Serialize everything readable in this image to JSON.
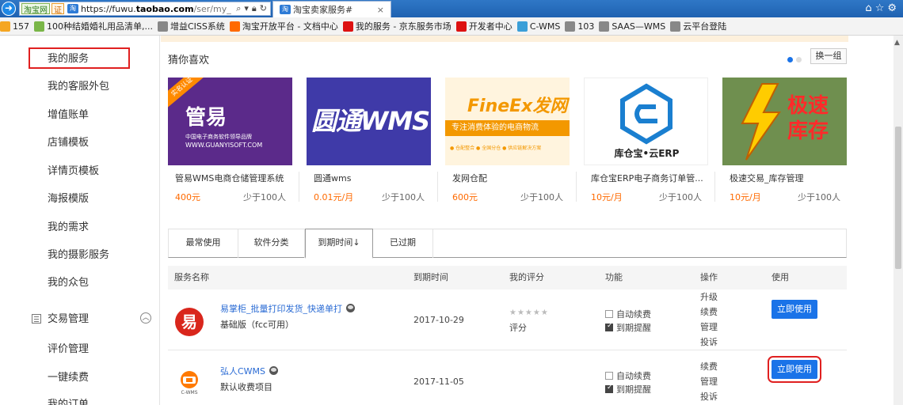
{
  "browser": {
    "chips": [
      "淘宝网",
      "证"
    ],
    "url_prefix": "https://fuwu.",
    "url_host": "taobao.com",
    "url_rest": "/ser/my_",
    "tab_title": "淘宝卖家服务#",
    "bookmarks": [
      {
        "label": "157",
        "icon_color": "#f5a623"
      },
      {
        "label": "100种结婚婚礼用品清单,...",
        "icon_color": "#7ab648"
      },
      {
        "label": "增益CISS系统",
        "icon_color": "#888888"
      },
      {
        "label": "淘宝开放平台 - 文档中心",
        "icon_color": "#ff6a00"
      },
      {
        "label": "我的服务 - 京东服务市场",
        "icon_color": "#d11"
      },
      {
        "label": "开发者中心",
        "icon_color": "#d11"
      },
      {
        "label": "C-WMS",
        "icon_color": "#3b9fd8"
      },
      {
        "label": "103",
        "icon_color": "#888888"
      },
      {
        "label": "SAAS—WMS",
        "icon_color": "#888888"
      },
      {
        "label": "云平台登陆",
        "icon_color": "#888888"
      }
    ]
  },
  "sidebar": {
    "items": [
      "我的服务",
      "我的客服外包",
      "增值账单",
      "店铺模板",
      "详情页模板",
      "海报模版",
      "我的需求",
      "我的摄影服务",
      "我的众包"
    ],
    "group_label": "交易管理",
    "group_toggle": "︿",
    "sub_items": [
      "评价管理",
      "一键续费",
      "我的订单"
    ]
  },
  "recommend": {
    "title": "猜你喜欢",
    "switch_label": "换一组",
    "cards": [
      {
        "name": "管易WMS电商仓储管理系统",
        "price": "400元",
        "sales": "少于100人",
        "img_text": "管易",
        "img_sub": "中国电子商务软件领导品牌",
        "img_url": "WWW.GUANYISOFT.COM",
        "badge": "实名认证"
      },
      {
        "name": "圆通wms",
        "price": "0.01元/月",
        "sales": "少于100人",
        "img_text": "圆通WMS"
      },
      {
        "name": "发网仓配",
        "price": "600元",
        "sales": "少于100人",
        "img_text": "FineEx发网",
        "img_sub": "专注消费体验的电商物流",
        "img_tags": "● 仓配整合   ● 全国分仓   ● 供应链解决方案"
      },
      {
        "name": "库仓宝ERP电子商务订单管...",
        "price": "10元/月",
        "sales": "少于100人",
        "img_text": "库仓宝•云ERP"
      },
      {
        "name": "极速交易_库存管理",
        "price": "10元/月",
        "sales": "少于100人",
        "img_text": "极速库存"
      }
    ]
  },
  "tabs": [
    "最常使用",
    "软件分类",
    "到期时间↓",
    "已过期"
  ],
  "table": {
    "headers": {
      "name": "服务名称",
      "expire": "到期时间",
      "rating": "我的评分",
      "features": "功能",
      "ops": "操作",
      "use": "使用"
    },
    "rows": [
      {
        "name": "易掌柜_批量打印发货_快递单打",
        "sub": "基础版（fcc可用）",
        "expire": "2017-10-29",
        "stars": "★★★★★",
        "rating_label": "评分",
        "auto_renew": "自动续费",
        "expire_remind": "到期提醒",
        "ops": [
          "升级",
          "续费",
          "管理",
          "投诉"
        ],
        "use_label": "立即使用",
        "logo_text": "易"
      },
      {
        "name": "弘人CWMS",
        "sub": "默认收费项目",
        "expire": "2017-11-05",
        "auto_renew": "自动续费",
        "expire_remind": "到期提醒",
        "ops": [
          "续费",
          "管理",
          "投诉"
        ],
        "use_label": "立即使用",
        "logo_text": "C-WMS"
      }
    ]
  }
}
